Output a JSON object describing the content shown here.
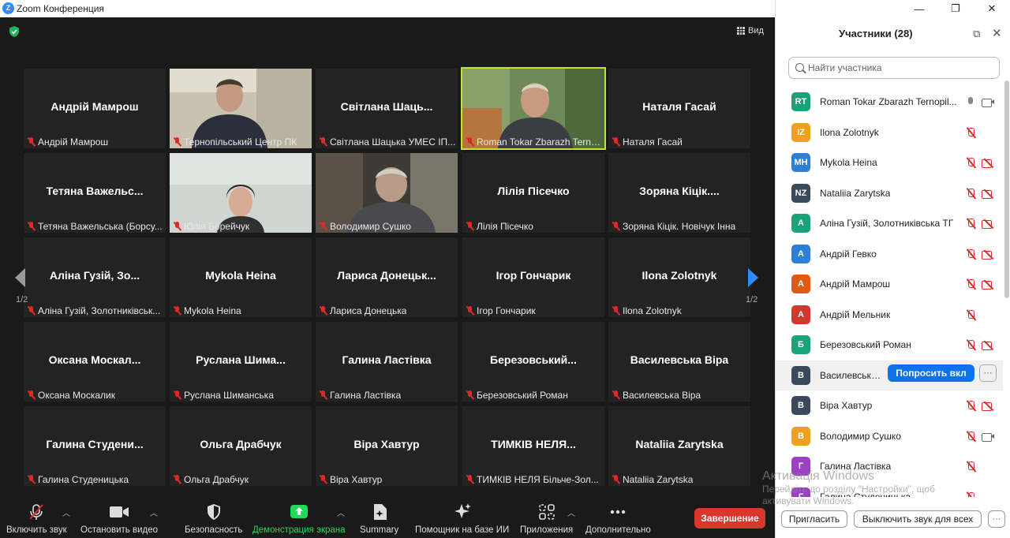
{
  "window": {
    "title": "Zoom Конференция",
    "logo": "Z",
    "controls": [
      "—",
      "❐",
      "✕"
    ]
  },
  "video": {
    "view_label": "Вид",
    "page_left": "1/2",
    "page_right": "1/2",
    "tiles": [
      {
        "big": "Андрій Мамрош",
        "cap": "Андрій Мамрош"
      },
      {
        "big": "",
        "cap": "Тернопільський Центр ПК"
      },
      {
        "big": "Світлана Шаць...",
        "cap": "Світлана Шацька УМЕС ІП..."
      },
      {
        "big": "",
        "cap": "Roman Tokar Zbarazh Ternopi..."
      },
      {
        "big": "Наталя Гасай",
        "cap": "Наталя Гасай"
      },
      {
        "big": "Тетяна Важельс...",
        "cap": "Тетяна Важельська (Борсу..."
      },
      {
        "big": "",
        "cap": "Юлія Борейчук"
      },
      {
        "big": "",
        "cap": "Володимир Сушко"
      },
      {
        "big": "Лілія Пісечко",
        "cap": "Лілія Пісечко"
      },
      {
        "big": "Зоряна Кіцік....",
        "cap": "Зоряна Кіцік. Новічук Інна"
      },
      {
        "big": "Аліна Гузій, Зо...",
        "cap": "Аліна Гузій, Золотниківськ..."
      },
      {
        "big": "Mykola Heina",
        "cap": "Mykola Heina"
      },
      {
        "big": "Лариса Донецьк...",
        "cap": "Лариса Донецька"
      },
      {
        "big": "Ігор Гончарик",
        "cap": "Ігор Гончарик"
      },
      {
        "big": "Ilona Zolotnyk",
        "cap": "Ilona Zolotnyk"
      },
      {
        "big": "Оксана Москал...",
        "cap": "Оксана Москалик"
      },
      {
        "big": "Руслана Шима...",
        "cap": "Руслана Шиманська"
      },
      {
        "big": "Галина Ластівка",
        "cap": "Галина Ластівка"
      },
      {
        "big": "Березовський...",
        "cap": "Березовський Роман"
      },
      {
        "big": "Василевська Віра",
        "cap": "Василевська Віра"
      },
      {
        "big": "Галина Студени...",
        "cap": "Галина Студеницька"
      },
      {
        "big": "Ольга Драбчук",
        "cap": "Ольга Драбчук"
      },
      {
        "big": "Віра Хавтур",
        "cap": "Віра Хавтур"
      },
      {
        "big": "ТИМКІВ НЕЛЯ...",
        "cap": "ТИМКІВ НЕЛЯ Більче-Зол..."
      },
      {
        "big": "Nataliia Zarytska",
        "cap": "Nataliia Zarytska"
      }
    ]
  },
  "toolbar": {
    "unmute": "Включить звук",
    "stop_video": "Остановить видео",
    "security": "Безопасность",
    "share": "Демонстрация экрана",
    "summary": "Summary",
    "ai": "Помощник на базе ИИ",
    "apps": "Приложения",
    "more": "Дополнительно",
    "end": "Завершение",
    "share_color": "#23d959"
  },
  "panel": {
    "title": "Участники (28)",
    "search_placeholder": "Найти участника",
    "ask_button": "Попросить вкл",
    "more_button": "···",
    "invite": "Пригласить",
    "mute_all": "Выключить звук для всех",
    "participants": [
      {
        "initials": "RT",
        "name": "Roman Tokar Zbarazh Ternopil...",
        "color": "#1aa37a",
        "mic": "on",
        "cam": "on"
      },
      {
        "initials": "IZ",
        "name": "Ilona Zolotnyk",
        "color": "#f0a020",
        "mic": "off",
        "cam": "none"
      },
      {
        "initials": "MH",
        "name": "Mykola Heina",
        "color": "#2d7fd3",
        "mic": "off",
        "cam": "off"
      },
      {
        "initials": "NZ",
        "name": "Nataliia Zarytska",
        "color": "#3a4a5c",
        "mic": "off",
        "cam": "off"
      },
      {
        "initials": "А",
        "name": "Аліна Гузій, Золотниківська ТГ",
        "color": "#1aa37a",
        "mic": "off",
        "cam": "off"
      },
      {
        "initials": "А",
        "name": "Андрій Гевко",
        "color": "#2d7fd3",
        "mic": "off",
        "cam": "off"
      },
      {
        "initials": "А",
        "name": "Андрій Мамрош",
        "color": "#e05a10",
        "mic": "off",
        "cam": "off"
      },
      {
        "initials": "А",
        "name": "Андрій Мельник",
        "color": "#d03a2e",
        "mic": "off",
        "cam": "none"
      },
      {
        "initials": "Б",
        "name": "Березовський Роман",
        "color": "#1aa37a",
        "mic": "off",
        "cam": "off"
      },
      {
        "initials": "В",
        "name": "Василевська ...",
        "color": "#3a4a5c",
        "mic": "none",
        "cam": "none"
      },
      {
        "initials": "В",
        "name": "Віра Хавтур",
        "color": "#3a4a5c",
        "mic": "off",
        "cam": "off"
      },
      {
        "initials": "В",
        "name": "Володимир Сушко",
        "color": "#f0a020",
        "mic": "off",
        "cam": "on"
      },
      {
        "initials": "Г",
        "name": "Галина Ластівка",
        "color": "#9b3fc4",
        "mic": "off",
        "cam": "none"
      },
      {
        "initials": "Г",
        "name": "Галина Студеницька",
        "color": "#9b3fc4",
        "mic": "off",
        "cam": "none"
      }
    ]
  },
  "watermark": {
    "line1": "Активація Windows",
    "line2": "Перейдіть до розділу \"Настройки\", щоб",
    "line3": "активувати Windows."
  }
}
